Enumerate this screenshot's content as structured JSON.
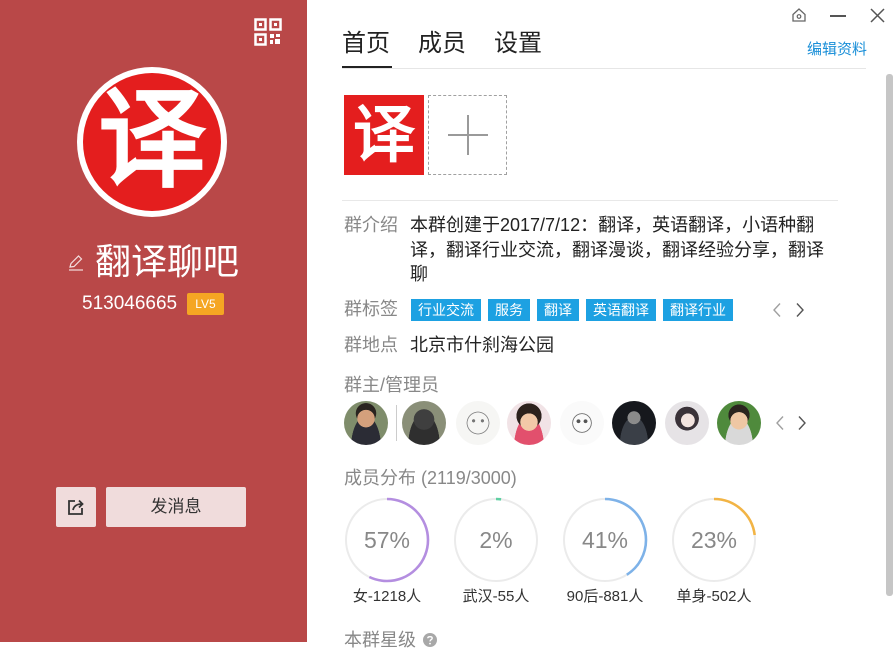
{
  "window": {
    "house_icon": "house-icon",
    "minimize_icon": "minimize-icon",
    "close_icon": "close-icon"
  },
  "profile": {
    "qr_icon": "qr-code-icon",
    "avatar_char": "译",
    "edit_icon": "pencil-icon",
    "name": "翻译聊吧",
    "group_number": "513046665",
    "level": "LV5",
    "share_icon": "share-icon",
    "send_message": "发消息"
  },
  "tabs": [
    {
      "label": "首页",
      "active": true
    },
    {
      "label": "成员",
      "active": false
    },
    {
      "label": "设置",
      "active": false
    }
  ],
  "edit_profile": "编辑资料",
  "group_avatar": {
    "char": "译",
    "add_icon": "plus-icon"
  },
  "intro": {
    "label": "群介绍",
    "text": "本群创建于2017/7/12：翻译，英语翻译，小语种翻译，翻译行业交流，翻译漫谈，翻译经验分享，翻译聊"
  },
  "tags": {
    "label": "群标签",
    "items": [
      "行业交流",
      "服务",
      "翻译",
      "英语翻译",
      "翻译行业"
    ],
    "prev_icon": "chevron-left-icon",
    "next_icon": "chevron-right-icon"
  },
  "location": {
    "label": "群地点",
    "value": "北京市什刹海公园"
  },
  "admins": {
    "label": "群主/管理员",
    "prev_icon": "chevron-left-icon",
    "next_icon": "chevron-right-icon"
  },
  "distribution": {
    "label": "成员分布",
    "count": "(2119/3000)",
    "items": [
      {
        "percent": "57%",
        "value": 0.57,
        "caption": "女-1218人",
        "color": "#b48ee0"
      },
      {
        "percent": "2%",
        "value": 0.02,
        "caption": "武汉-55人",
        "color": "#5fcfa2"
      },
      {
        "percent": "41%",
        "value": 0.41,
        "caption": "90后-881人",
        "color": "#7eb2e8"
      },
      {
        "percent": "23%",
        "value": 0.23,
        "caption": "单身-502人",
        "color": "#f2b445"
      }
    ]
  },
  "star_level": {
    "label": "本群星级",
    "help_icon": "question-icon"
  },
  "colors": {
    "sidebar": "#b94848",
    "avatar_red": "#e41e1e",
    "tag": "#1da1e2",
    "link": "#1a8fd8",
    "level_badge": "#f5a623"
  }
}
